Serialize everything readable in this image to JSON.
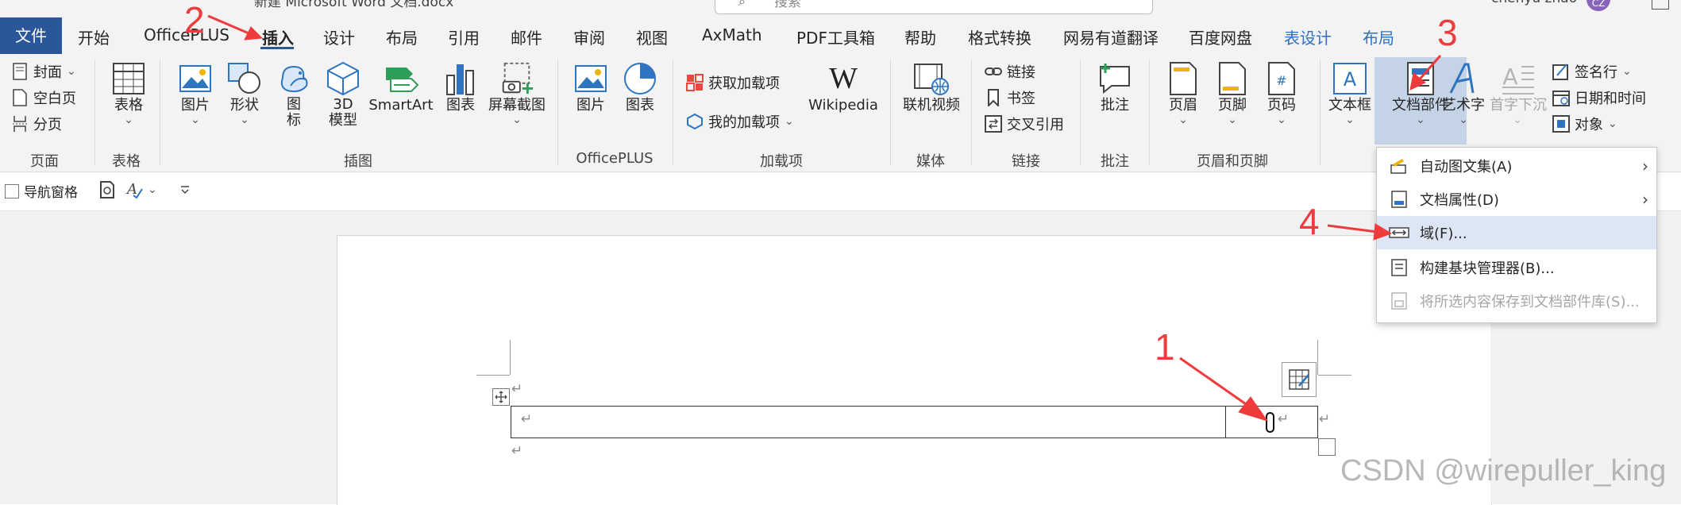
{
  "titlebar": {
    "doc_title": "新建 Microsoft Word 文档.docx",
    "search_placeholder": "搜索",
    "username": "chenyu zhao",
    "avatar_initials": "CZ"
  },
  "tabs": {
    "file": "文件",
    "home": "开始",
    "officeplus": "OfficePLUS",
    "insert": "插入",
    "design": "设计",
    "layout": "布局",
    "references": "引用",
    "mailings": "邮件",
    "review": "审阅",
    "view": "视图",
    "axmath": "AxMath",
    "pdf": "PDF工具箱",
    "help": "帮助",
    "convert": "格式转换",
    "youdao": "网易有道翻译",
    "baidu": "百度网盘",
    "table_design": "表设计",
    "table_layout": "布局"
  },
  "ribbon": {
    "pages": {
      "cover": "封面",
      "blank": "空白页",
      "break": "分页",
      "group": "页面"
    },
    "tables": {
      "table": "表格",
      "group": "表格"
    },
    "illustrations": {
      "pictures": "图片",
      "shapes": "形状",
      "icons": "图\n标",
      "model3d": "3D\n模型",
      "smartart": "SmartArt",
      "chart": "图表",
      "screenshot": "屏幕截图",
      "group": "插图"
    },
    "officeplus": {
      "picture": "图片",
      "chart": "图表",
      "group": "OfficePLUS"
    },
    "addins": {
      "get": "获取加载项",
      "my": "我的加载项",
      "wikipedia": "Wikipedia",
      "group": "加载项"
    },
    "media": {
      "online_video": "联机视频",
      "group": "媒体"
    },
    "links": {
      "link": "链接",
      "bookmark": "书签",
      "crossref": "交叉引用",
      "group": "链接"
    },
    "comments": {
      "comment": "批注",
      "group": "批注"
    },
    "header_footer": {
      "header": "页眉",
      "footer": "页脚",
      "page_number": "页码",
      "group": "页眉和页脚"
    },
    "text": {
      "textbox": "文本框",
      "docparts": "文档部件",
      "wordart": "艺术字",
      "dropcap": "首字下沉",
      "signature": "签名行",
      "datetime": "日期和时间",
      "object": "对象"
    }
  },
  "qat": {
    "nav_pane": "导航窗格"
  },
  "dropdown": {
    "items": [
      {
        "label": "自动图文集(A)",
        "submenu": true,
        "enabled": true
      },
      {
        "label": "文档属性(D)",
        "submenu": true,
        "enabled": true
      },
      {
        "label": "域(F)...",
        "submenu": false,
        "enabled": true,
        "highlighted": true
      },
      {
        "label": "构建基块管理器(B)...",
        "submenu": false,
        "enabled": true
      },
      {
        "label": "将所选内容保存到文档部件库(S)...",
        "submenu": false,
        "enabled": false
      }
    ]
  },
  "annotations": {
    "step1": "1",
    "step2": "2",
    "step3": "3",
    "step4": "4"
  },
  "watermark": "CSDN @wirepuller_king",
  "colors": {
    "accent": "#2b579a",
    "annotation": "#ef3b3b",
    "menu_highlight": "#dce6f4"
  }
}
